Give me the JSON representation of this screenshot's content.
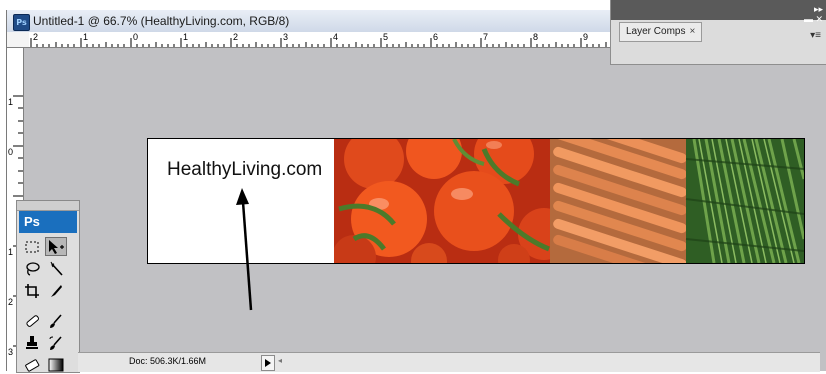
{
  "document": {
    "title": "Untitled-1 @ 66.7% (HealthyLiving.com, RGB/8)",
    "icon": "photoshop-document-icon"
  },
  "rulers": {
    "top_labels": [
      "2",
      "1",
      "0",
      "1",
      "2",
      "3",
      "4",
      "5",
      "6",
      "7",
      "8",
      "9"
    ],
    "left_labels": [
      "1",
      "0",
      "1",
      "2",
      "3"
    ]
  },
  "canvas": {
    "site_title": "HealthyLiving.com",
    "photos": [
      "tomatoes",
      "carrots",
      "green-vegetables"
    ]
  },
  "tools_panel": {
    "logo": "Ps",
    "tools": [
      "rectangular-marquee-tool",
      "move-tool",
      "lasso-tool",
      "magic-wand-tool",
      "crop-tool",
      "slice-tool",
      "healing-brush-tool",
      "brush-tool",
      "clone-stamp-tool",
      "history-brush-tool",
      "eraser-tool",
      "gradient-tool"
    ]
  },
  "status_bar": {
    "doc_info": "Doc: 506.3K/1.66M"
  },
  "layer_comps_panel": {
    "tab_label": "Layer Comps",
    "close_glyph": "×"
  },
  "colors": {
    "workspace": "#c1c1c4",
    "ps_blue": "#1a6fbe"
  }
}
